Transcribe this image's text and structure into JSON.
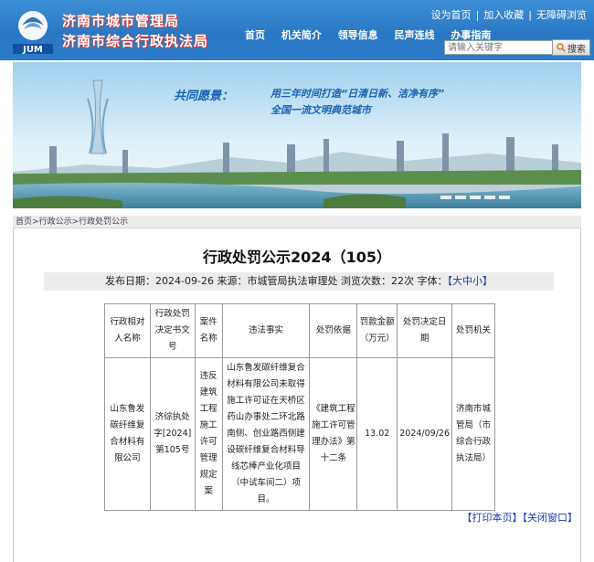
{
  "header": {
    "logo_text": "JUM",
    "org_name_1": "济南市城市管理局",
    "org_name_2": "济南市综合行政执法局",
    "top_links": [
      "设为首页",
      "加入收藏",
      "无障碍浏览"
    ],
    "nav": [
      "首页",
      "机关简介",
      "领导信息",
      "民声连线",
      "办事指南"
    ],
    "search": {
      "placeholder": "请输入关键字",
      "button_label": "搜索"
    }
  },
  "banner": {
    "slogan_prefix": "共同愿景：",
    "slogan_line1": "用三年时间打造“日清日新、洁净有序”",
    "slogan_line2": "全国一流文明典范城市"
  },
  "breadcrumb": [
    "首页",
    "行政公示",
    "行政处罚公示"
  ],
  "article": {
    "title": "行政处罚公示2024（105）",
    "publish_label": "发布日期：",
    "publish_date": "2024-09-26",
    "source_label": "来源：",
    "source": "市城管局执法审理处",
    "views_label": "浏览次数：",
    "views": "22次",
    "font_label": "字体：",
    "font_size_options": "【大中小】"
  },
  "table": {
    "headers": [
      "行政相对人名称",
      "行政处罚决定书文号",
      "案件名称",
      "违法事实",
      "处罚依据",
      "罚款金额（万元）",
      "处罚决定日期",
      "处罚机关"
    ],
    "rows": [
      [
        "山东鲁发碳纤维复合材料有限公司",
        "济综执处字[2024]第105号",
        "违反建筑工程施工许可管理规定案",
        "山东鲁发碳纤维复合材料有限公司未取得施工许可证在天桥区药山办事处二环北路南侧、创业路西侧建设碳纤维复合材料导线芯棒产业化项目（中试车间二）项目。",
        "《建筑工程施工许可管理办法》第十二条",
        "13.02",
        "2024/09/26",
        "济南市城管局（市综合行政执法局）"
      ]
    ]
  },
  "actions": {
    "print": "【打印本页】",
    "close": "【关闭窗口】"
  }
}
